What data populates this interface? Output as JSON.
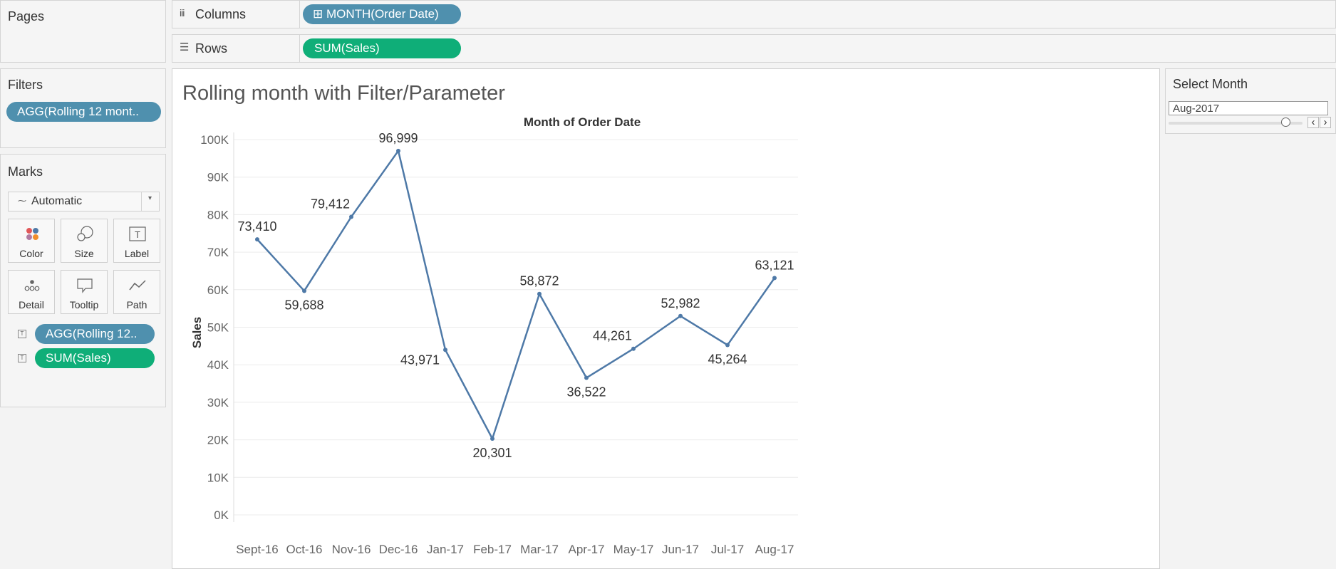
{
  "pages": {
    "title": "Pages"
  },
  "columns": {
    "label": "Columns",
    "pill": "⊞ MONTH(Order Date)"
  },
  "rows": {
    "label": "Rows",
    "pill": "SUM(Sales)"
  },
  "filters": {
    "title": "Filters",
    "pill": "AGG(Rolling 12 mont.."
  },
  "marks": {
    "title": "Marks",
    "type": "Automatic",
    "cards": [
      "Color",
      "Size",
      "Label",
      "Detail",
      "Tooltip",
      "Path"
    ],
    "fields": [
      "AGG(Rolling 12..",
      "SUM(Sales)"
    ]
  },
  "view": {
    "title": "Rolling month with Filter/Parameter"
  },
  "parameter": {
    "title": "Select Month",
    "value": "Aug-2017"
  },
  "colors": {
    "pill_blue": "#4f90ae",
    "pill_green": "#0fae78",
    "line": "#4e79a7"
  },
  "chart_data": {
    "type": "line",
    "title": "Month of Order Date",
    "xlabel": "",
    "ylabel": "Sales",
    "categories": [
      "Sept-16",
      "Oct-16",
      "Nov-16",
      "Dec-16",
      "Jan-17",
      "Feb-17",
      "Mar-17",
      "Apr-17",
      "May-17",
      "Jun-17",
      "Jul-17",
      "Aug-17"
    ],
    "values": [
      73410,
      59688,
      79412,
      96999,
      43971,
      20301,
      58872,
      36522,
      44261,
      52982,
      45264,
      63121
    ],
    "value_labels": [
      "73,410",
      "59,688",
      "79,412",
      "96,999",
      "43,971",
      "20,301",
      "58,872",
      "36,522",
      "44,261",
      "52,982",
      "45,264",
      "63,121"
    ],
    "ylim": [
      0,
      100000
    ],
    "yticks": [
      0,
      10000,
      20000,
      30000,
      40000,
      50000,
      60000,
      70000,
      80000,
      90000,
      100000
    ],
    "ytick_labels": [
      "0K",
      "10K",
      "20K",
      "30K",
      "40K",
      "50K",
      "60K",
      "70K",
      "80K",
      "90K",
      "100K"
    ],
    "grid": true
  }
}
